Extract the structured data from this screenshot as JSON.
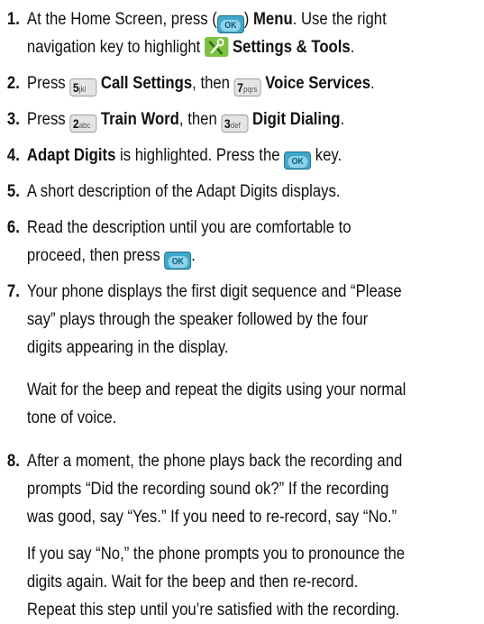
{
  "steps": [
    {
      "number": "1.",
      "line1_a": "At the Home Screen, press (",
      "line1_b": ") ",
      "menu": "Menu",
      "line1_c": ". Use the right",
      "line2_a": "navigation key to highlight ",
      "settings_tools": "Settings & Tools",
      "line2_b": "."
    },
    {
      "number": "2.",
      "press": "Press ",
      "call_settings": "Call Settings",
      "then": ", then ",
      "voice_services": "Voice Services",
      "end": "."
    },
    {
      "number": "3.",
      "press": "Press ",
      "train_word": "Train Word",
      "then": ", then ",
      "digit_dialing": "Digit Dialing",
      "end": "."
    },
    {
      "number": "4.",
      "adapt_digits": "Adapt Digits",
      "text_a": " is highlighted. Press the ",
      "text_b": " key."
    },
    {
      "number": "5.",
      "text": "A short description of the Adapt Digits displays."
    },
    {
      "number": "6.",
      "line1": "Read the description until you are comfortable to",
      "line2_a": "proceed, then press ",
      "line2_b": "."
    },
    {
      "number": "7.",
      "line1": "Your phone displays the first digit sequence and “Please",
      "line2": "say” plays through the speaker followed by the four",
      "line3": "digits appearing in the display.",
      "para2_line1": "Wait for the beep and repeat the digits using your normal",
      "para2_line2": "tone of voice."
    },
    {
      "number": "8.",
      "line1": "After a moment, the phone plays back the recording and",
      "line2": "prompts “Did the recording sound ok?” If the recording",
      "line3": "was good, say “Yes.” If you need to re-record, say “No.”",
      "para2_line1": "If you say “No,” the phone prompts you to pronounce the",
      "para2_line2": "digits again. Wait for the beep and then re-record.",
      "para2_line3": "Repeat this step until you’re satisfied with the recording."
    }
  ],
  "keys": {
    "ok": "OK",
    "five_digit": "5",
    "five_letters": "jkl",
    "seven_digit": "7",
    "seven_letters": "pqrs",
    "two_digit": "2",
    "two_letters": "abc",
    "three_digit": "3",
    "three_letters": "def"
  },
  "colors": {
    "ok_key": "#3fa7c9",
    "tools_icon": "#7cc142"
  }
}
